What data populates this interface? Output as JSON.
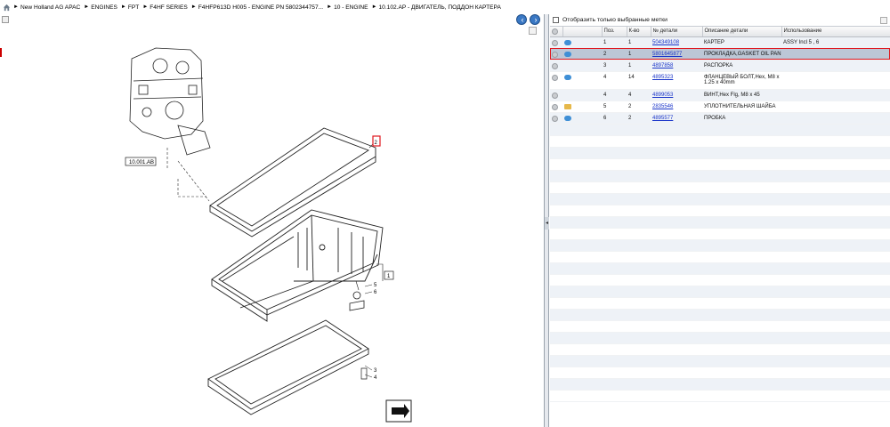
{
  "breadcrumb": {
    "home_icon": "home-icon",
    "items": [
      "New Holland AG APAC",
      "ENGINES",
      "FPT",
      "F4HF SERIES",
      "F4HFP613D H005 - ENGINE PN 5802344757...",
      "10 - ENGINE",
      "10.102.AP - ДВИГАТЕЛЬ, ПОДДОН КАРТЕРА"
    ]
  },
  "diagram": {
    "ref_box": "10.001.AB",
    "callout_highlight": "2",
    "callouts": [
      "1",
      "5",
      "6",
      "3",
      "4"
    ]
  },
  "parts_panel": {
    "filter_label": "Отобразить только выбранные метки",
    "columns": [
      "",
      "",
      "Поз.",
      "К-во",
      "№ детали",
      "Описание детали",
      "Использование"
    ],
    "rows": [
      {
        "pos": "1",
        "qty": "1",
        "part": "504349108",
        "desc": "КАРТЕР",
        "usage": "ASSY Incl 5 , 6",
        "icon": "blue"
      },
      {
        "pos": "2",
        "qty": "1",
        "part": "5801645877",
        "desc": "ПРОКЛАДКА,GASKET  OIL PAN",
        "usage": "",
        "icon": "blue"
      },
      {
        "pos": "3",
        "qty": "1",
        "part": "4897858",
        "desc": "РАСПОРКА",
        "usage": "",
        "icon": ""
      },
      {
        "pos": "4",
        "qty": "14",
        "part": "4895323",
        "desc": "ФЛАНЦЕВЫЙ БОЛТ,Hex, M8 x 1.25 x 40mm",
        "usage": "",
        "icon": "blue"
      },
      {
        "pos": "4",
        "qty": "4",
        "part": "4899053",
        "desc": "ВИНТ,Hex Flg, M8 x 45",
        "usage": "",
        "icon": ""
      },
      {
        "pos": "5",
        "qty": "2",
        "part": "2835546",
        "desc": "УПЛОТНИТЕЛЬНАЯ ШАЙБА",
        "usage": "",
        "icon": "box"
      },
      {
        "pos": "6",
        "qty": "2",
        "part": "4895577",
        "desc": "ПРОБКА",
        "usage": "",
        "icon": "blue"
      }
    ]
  }
}
